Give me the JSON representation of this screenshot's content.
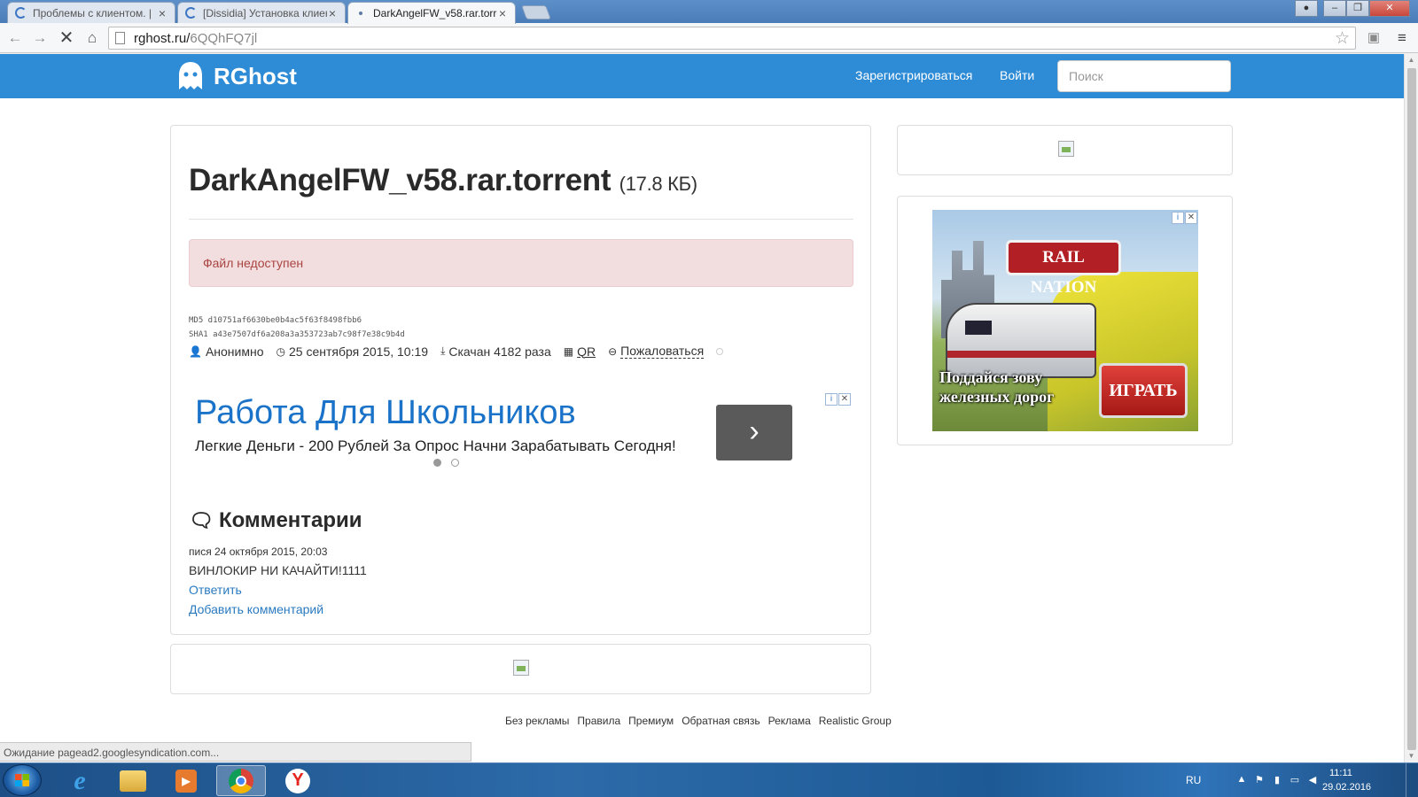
{
  "browser": {
    "tabs": [
      {
        "title": "Проблемы с клиентом. | "
      },
      {
        "title": "[Dissidia] Установка клиен"
      },
      {
        "title": "DarkAngelFW_v58.rar.torre"
      }
    ],
    "address": {
      "host": "rghost.ru/",
      "path": "6QQhFQ7jl"
    },
    "status": "Ожидание pagead2.googlesyndication.com..."
  },
  "site": {
    "logo_text": "RGhost",
    "nav": {
      "register": "Зарегистрироваться",
      "login": "Войти"
    },
    "search_placeholder": "Поиск"
  },
  "file": {
    "name": "DarkAngelFW_v58.rar.torrent",
    "size": "(17.8 КБ)",
    "alert": "Файл недоступен",
    "md5": "MD5  d10751af6630be0b4ac5f63f8498fbb6",
    "sha1": "SHA1 a43e7507df6a208a3a353723ab7c98f7e38c9b4d",
    "author": "Анонимно",
    "date": "25 сентября 2015, 10:19",
    "downloads": "Скачан 4182 раза",
    "qr": "QR",
    "report": "Пожаловаться"
  },
  "ad": {
    "headline": "Работа Для Школьников",
    "body": "Легкие Деньги - 200 Рублей За Опрос Начни Зарабатывать Сегодня!",
    "go": "›",
    "adchoices": "i",
    "close": "✕"
  },
  "comments": {
    "heading": "Комментарии",
    "items": [
      {
        "author": "пися",
        "date": "24 октября 2015, 20:03",
        "text": "ВИНЛОКИР НИ КАЧАЙТИ!1111"
      }
    ],
    "reply": "Ответить",
    "add": "Добавить комментарий"
  },
  "banner": {
    "logo": "RAIL NATION",
    "caption_line1": "Поддайся зову",
    "caption_line2": "железных дорог",
    "play": "ИГРАТЬ"
  },
  "footer": [
    "Без рекламы",
    "Правила",
    "Премиум",
    "Обратная связь",
    "Реклама",
    "Realistic Group"
  ],
  "taskbar": {
    "lang": "RU",
    "time": "11:11",
    "date": "29.02.2016"
  }
}
